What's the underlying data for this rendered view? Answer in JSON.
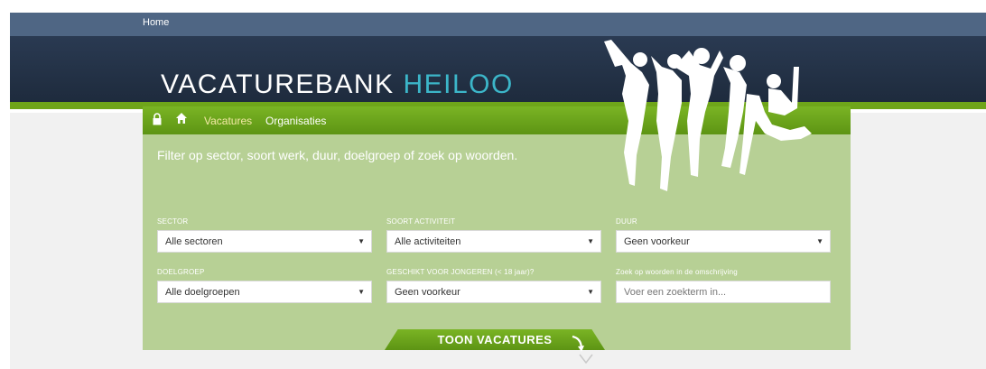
{
  "topbar": {
    "home_label": "Home"
  },
  "logo": {
    "part1": "VACATUREBANK",
    "part2": "HEILOO"
  },
  "nav": {
    "vacatures": "Vacatures",
    "organisaties": "Organisaties"
  },
  "intro": "Filter op sector, soort werk, duur, doelgroep of zoek op woorden.",
  "filters": {
    "sector": {
      "label": "SECTOR",
      "value": "Alle sectoren"
    },
    "soort": {
      "label": "SOORT ACTIVITEIT",
      "value": "Alle activiteiten"
    },
    "duur": {
      "label": "DUUR",
      "value": "Geen voorkeur"
    },
    "doelgroep": {
      "label": "DOELGROEP",
      "value": "Alle doelgroepen"
    },
    "jongeren": {
      "label": "GESCHIKT VOOR JONGEREN (< 18 jaar)?",
      "value": "Geen voorkeur"
    },
    "zoek": {
      "label": "Zoek op woorden in de omschrijving",
      "placeholder": "Voer een zoekterm in..."
    }
  },
  "cta": {
    "label": "TOON VACATURES"
  },
  "colors": {
    "accent_green": "#6fa51a",
    "panel_green": "#b7d095",
    "logo_blue": "#3cb6c9",
    "header_navy": "#1e2b3d"
  }
}
